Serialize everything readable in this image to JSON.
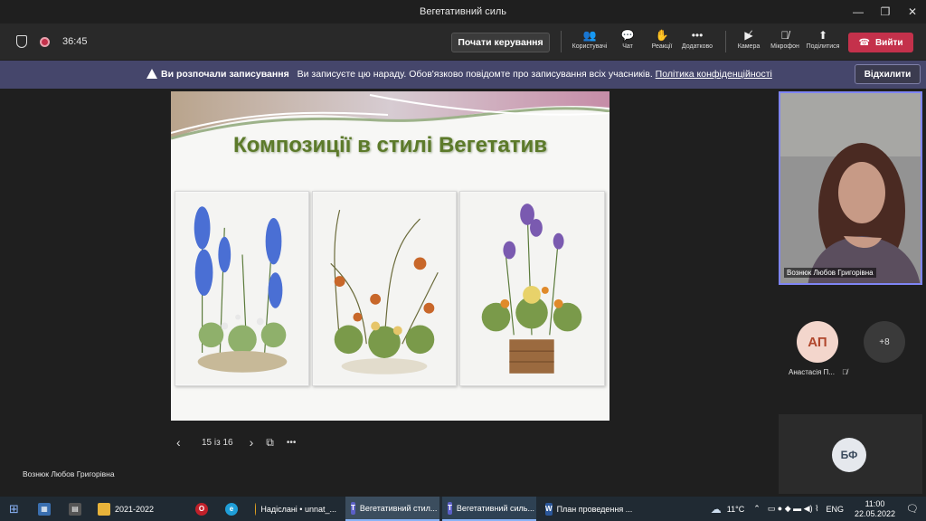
{
  "window": {
    "title": "Вегетативний силь"
  },
  "toolbar": {
    "timer": "36:45",
    "present_control": "Почати керування",
    "participants": "Користувачі",
    "chat": "Чат",
    "reactions": "Реакції",
    "more": "Додатково",
    "camera": "Камера",
    "mic": "Мікрофон",
    "share": "Поділитися",
    "leave": "Вийти"
  },
  "banner": {
    "title": "Ви розпочали записування",
    "text": "Ви записуєте цю нараду. Обов'язково повідомте про записування всіх учасників.",
    "link": "Політика конфіденційності",
    "dismiss": "Відхилити"
  },
  "slide": {
    "title": "Композиції в стилі Вегетатив",
    "counter": "15 із 16"
  },
  "participants": {
    "main_video_name": "Вознюк Любов Григорівна",
    "avatar1_initials": "АП",
    "avatar1_name": "Анастасія П...",
    "more_count": "+8",
    "avatar2_initials": "БФ"
  },
  "presenter_label": "Вознюк Любов Григорівна",
  "taskbar": {
    "folder": "2021-2022",
    "chrome": "Надіслані • unnat_...",
    "teams1": "Вегетативний стил...",
    "teams2": "Вегетативний силь...",
    "word": "План проведення ...",
    "temperature": "11°C",
    "lang": "ENG",
    "time": "11:00",
    "date": "22.05.2022"
  },
  "colors": {
    "leave": "#c4314b",
    "banner": "#45466b",
    "accent": "#7f85f5",
    "slide_title": "#5c7a2a"
  }
}
